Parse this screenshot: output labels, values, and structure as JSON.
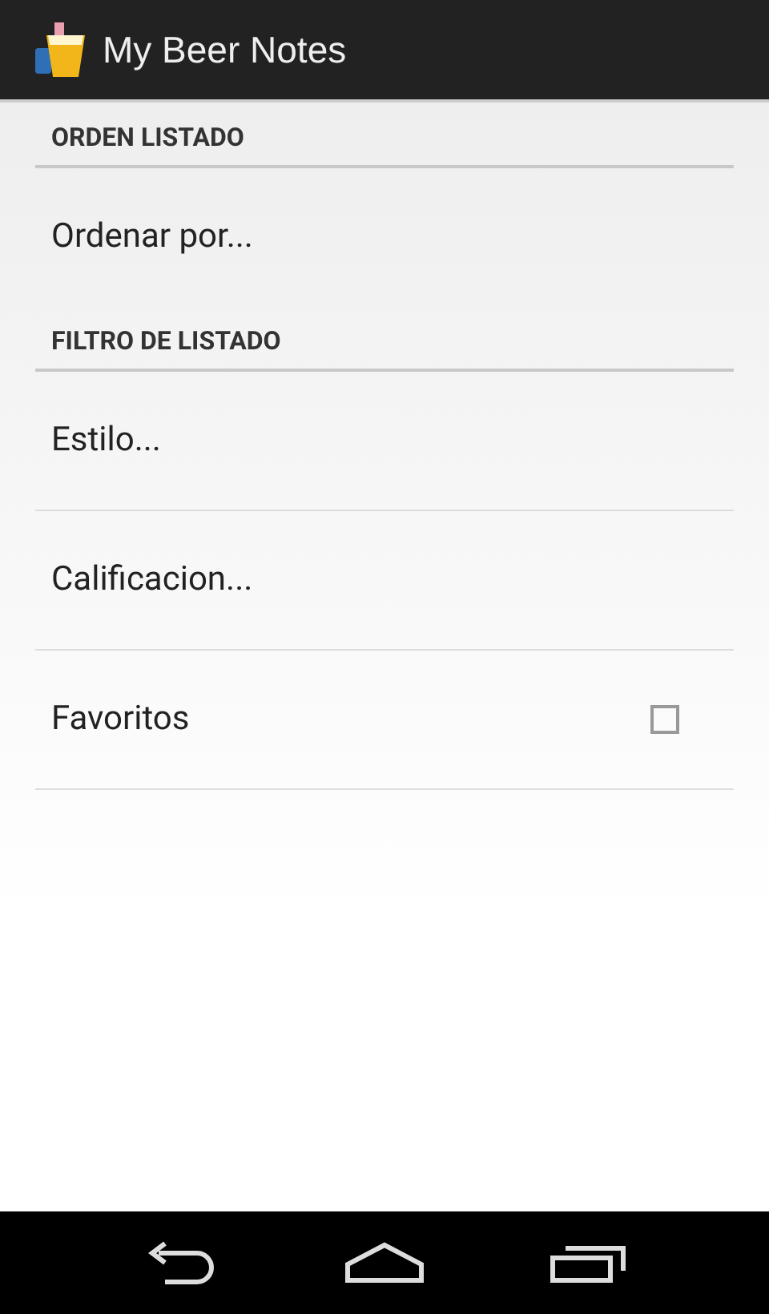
{
  "action_bar": {
    "title": "My Beer Notes"
  },
  "sections": [
    {
      "header": "ORDEN LISTADO",
      "items": [
        {
          "kind": "link",
          "label": "Ordenar por..."
        }
      ]
    },
    {
      "header": "FILTRO DE LISTADO",
      "items": [
        {
          "kind": "link",
          "label": "Estilo..."
        },
        {
          "kind": "link",
          "label": "Calificacion..."
        },
        {
          "kind": "checkbox",
          "label": "Favoritos",
          "checked": false
        }
      ]
    }
  ]
}
